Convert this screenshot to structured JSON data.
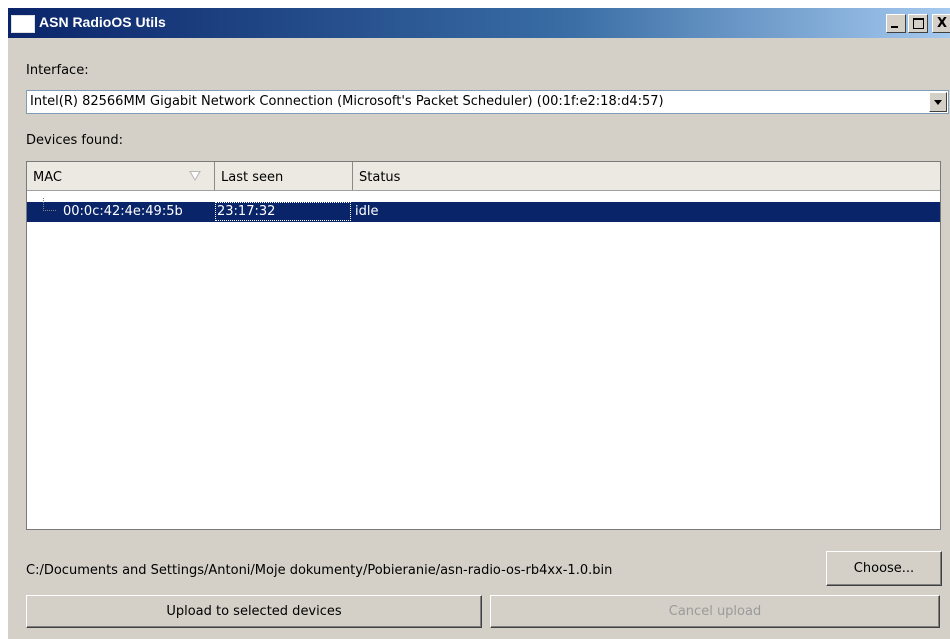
{
  "window": {
    "title": "ASN RadioOS Utils",
    "controls": {
      "minimize": "_",
      "maximize": "□",
      "close": "X"
    }
  },
  "interface": {
    "label": "Interface:",
    "selected": "Intel(R) 82566MM Gigabit Network Connection (Microsoft's Packet Scheduler)  (00:1f:e2:18:d4:57)"
  },
  "devices": {
    "label": "Devices found:",
    "columns": [
      "MAC",
      "Last seen",
      "Status"
    ],
    "sort_column": "MAC",
    "rows": [
      {
        "mac": "00:0c:42:4e:49:5b",
        "last_seen": "23:17:32",
        "status": "idle",
        "selected": true
      }
    ]
  },
  "file": {
    "path": "C:/Documents and Settings/Antoni/Moje dokumenty/Pobieranie/asn-radio-os-rb4xx-1.0.bin",
    "choose_label": "Choose..."
  },
  "actions": {
    "upload_label": "Upload to selected devices",
    "cancel_label": "Cancel upload",
    "cancel_enabled": false
  },
  "colors": {
    "title_bar_start": "#0a246a",
    "title_bar_end": "#a6caf0",
    "selection": "#0a246a",
    "window_bg": "#d4d0c8"
  }
}
